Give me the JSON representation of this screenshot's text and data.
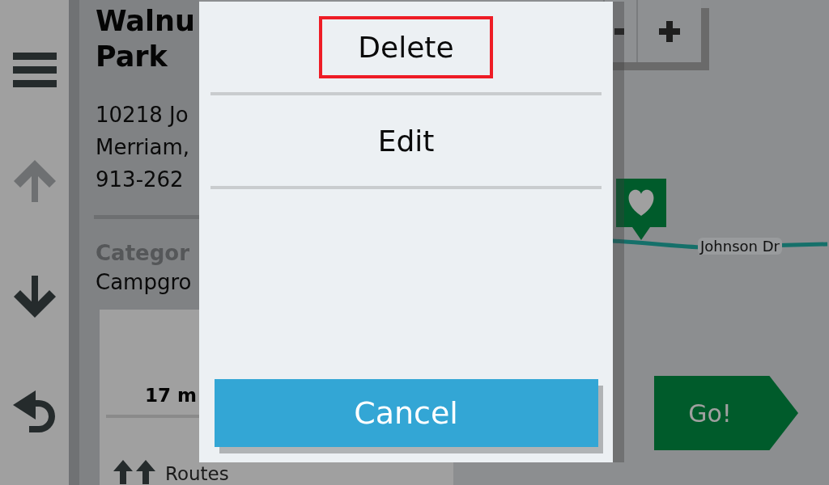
{
  "sidebar": {
    "buttons": [
      {
        "kind": "menu",
        "disabled": false
      },
      {
        "kind": "up",
        "disabled": true
      },
      {
        "kind": "down",
        "disabled": false
      },
      {
        "kind": "back",
        "disabled": false
      }
    ]
  },
  "details": {
    "title_lines": [
      "Walnu",
      "Park"
    ],
    "address_lines": [
      "10218 Jo",
      "Merriam,",
      "913-262"
    ],
    "category_label": "Categor",
    "category_value": "Campgro",
    "trip": {
      "time": "17 m",
      "routes_label": "Routes"
    }
  },
  "map": {
    "road_label": "Johnson Dr",
    "zoom_buttons": [
      {
        "kind": "minus"
      },
      {
        "kind": "plus"
      }
    ],
    "go_button": "Go!"
  },
  "dialog": {
    "items": [
      {
        "label": "Delete",
        "highlighted": true
      },
      {
        "label": "Edit",
        "highlighted": false
      }
    ],
    "cancel_button": "Cancel"
  }
}
